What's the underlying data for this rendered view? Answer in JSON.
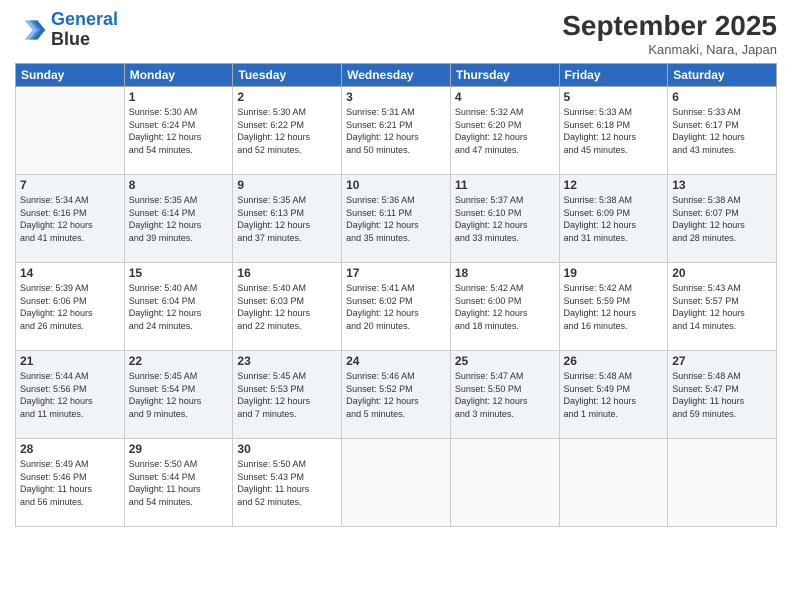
{
  "header": {
    "logo_line1": "General",
    "logo_line2": "Blue",
    "month": "September 2025",
    "location": "Kanmaki, Nara, Japan"
  },
  "days_of_week": [
    "Sunday",
    "Monday",
    "Tuesday",
    "Wednesday",
    "Thursday",
    "Friday",
    "Saturday"
  ],
  "weeks": [
    [
      {
        "day": "",
        "info": ""
      },
      {
        "day": "1",
        "info": "Sunrise: 5:30 AM\nSunset: 6:24 PM\nDaylight: 12 hours\nand 54 minutes."
      },
      {
        "day": "2",
        "info": "Sunrise: 5:30 AM\nSunset: 6:22 PM\nDaylight: 12 hours\nand 52 minutes."
      },
      {
        "day": "3",
        "info": "Sunrise: 5:31 AM\nSunset: 6:21 PM\nDaylight: 12 hours\nand 50 minutes."
      },
      {
        "day": "4",
        "info": "Sunrise: 5:32 AM\nSunset: 6:20 PM\nDaylight: 12 hours\nand 47 minutes."
      },
      {
        "day": "5",
        "info": "Sunrise: 5:33 AM\nSunset: 6:18 PM\nDaylight: 12 hours\nand 45 minutes."
      },
      {
        "day": "6",
        "info": "Sunrise: 5:33 AM\nSunset: 6:17 PM\nDaylight: 12 hours\nand 43 minutes."
      }
    ],
    [
      {
        "day": "7",
        "info": "Sunrise: 5:34 AM\nSunset: 6:16 PM\nDaylight: 12 hours\nand 41 minutes."
      },
      {
        "day": "8",
        "info": "Sunrise: 5:35 AM\nSunset: 6:14 PM\nDaylight: 12 hours\nand 39 minutes."
      },
      {
        "day": "9",
        "info": "Sunrise: 5:35 AM\nSunset: 6:13 PM\nDaylight: 12 hours\nand 37 minutes."
      },
      {
        "day": "10",
        "info": "Sunrise: 5:36 AM\nSunset: 6:11 PM\nDaylight: 12 hours\nand 35 minutes."
      },
      {
        "day": "11",
        "info": "Sunrise: 5:37 AM\nSunset: 6:10 PM\nDaylight: 12 hours\nand 33 minutes."
      },
      {
        "day": "12",
        "info": "Sunrise: 5:38 AM\nSunset: 6:09 PM\nDaylight: 12 hours\nand 31 minutes."
      },
      {
        "day": "13",
        "info": "Sunrise: 5:38 AM\nSunset: 6:07 PM\nDaylight: 12 hours\nand 28 minutes."
      }
    ],
    [
      {
        "day": "14",
        "info": "Sunrise: 5:39 AM\nSunset: 6:06 PM\nDaylight: 12 hours\nand 26 minutes."
      },
      {
        "day": "15",
        "info": "Sunrise: 5:40 AM\nSunset: 6:04 PM\nDaylight: 12 hours\nand 24 minutes."
      },
      {
        "day": "16",
        "info": "Sunrise: 5:40 AM\nSunset: 6:03 PM\nDaylight: 12 hours\nand 22 minutes."
      },
      {
        "day": "17",
        "info": "Sunrise: 5:41 AM\nSunset: 6:02 PM\nDaylight: 12 hours\nand 20 minutes."
      },
      {
        "day": "18",
        "info": "Sunrise: 5:42 AM\nSunset: 6:00 PM\nDaylight: 12 hours\nand 18 minutes."
      },
      {
        "day": "19",
        "info": "Sunrise: 5:42 AM\nSunset: 5:59 PM\nDaylight: 12 hours\nand 16 minutes."
      },
      {
        "day": "20",
        "info": "Sunrise: 5:43 AM\nSunset: 5:57 PM\nDaylight: 12 hours\nand 14 minutes."
      }
    ],
    [
      {
        "day": "21",
        "info": "Sunrise: 5:44 AM\nSunset: 5:56 PM\nDaylight: 12 hours\nand 11 minutes."
      },
      {
        "day": "22",
        "info": "Sunrise: 5:45 AM\nSunset: 5:54 PM\nDaylight: 12 hours\nand 9 minutes."
      },
      {
        "day": "23",
        "info": "Sunrise: 5:45 AM\nSunset: 5:53 PM\nDaylight: 12 hours\nand 7 minutes."
      },
      {
        "day": "24",
        "info": "Sunrise: 5:46 AM\nSunset: 5:52 PM\nDaylight: 12 hours\nand 5 minutes."
      },
      {
        "day": "25",
        "info": "Sunrise: 5:47 AM\nSunset: 5:50 PM\nDaylight: 12 hours\nand 3 minutes."
      },
      {
        "day": "26",
        "info": "Sunrise: 5:48 AM\nSunset: 5:49 PM\nDaylight: 12 hours\nand 1 minute."
      },
      {
        "day": "27",
        "info": "Sunrise: 5:48 AM\nSunset: 5:47 PM\nDaylight: 11 hours\nand 59 minutes."
      }
    ],
    [
      {
        "day": "28",
        "info": "Sunrise: 5:49 AM\nSunset: 5:46 PM\nDaylight: 11 hours\nand 56 minutes."
      },
      {
        "day": "29",
        "info": "Sunrise: 5:50 AM\nSunset: 5:44 PM\nDaylight: 11 hours\nand 54 minutes."
      },
      {
        "day": "30",
        "info": "Sunrise: 5:50 AM\nSunset: 5:43 PM\nDaylight: 11 hours\nand 52 minutes."
      },
      {
        "day": "",
        "info": ""
      },
      {
        "day": "",
        "info": ""
      },
      {
        "day": "",
        "info": ""
      },
      {
        "day": "",
        "info": ""
      }
    ]
  ]
}
